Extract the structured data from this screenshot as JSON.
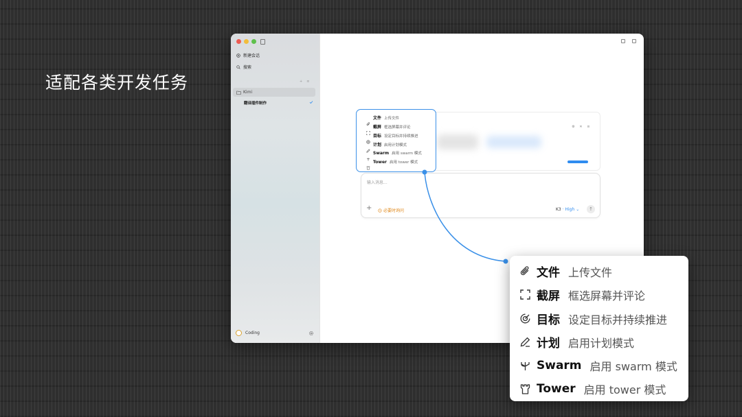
{
  "headline": "适配各类开发任务",
  "sidebar": {
    "new_chat": "新建会话",
    "search": "搜索",
    "section_label": "",
    "project": "Kimi",
    "task": "翻译插件制作",
    "footer_label": "Coding"
  },
  "composer": {
    "placeholder": "输入消息...",
    "plus": "+",
    "time_label": "必要时询问",
    "model_name": "K3",
    "model_level": "· High ⌄",
    "send": "↑"
  },
  "commands": [
    {
      "key": "file",
      "title": "文件",
      "desc": "上传文件",
      "icon": "paperclip-icon"
    },
    {
      "key": "screenshot",
      "title": "截屏",
      "desc": "框选屏幕并评论",
      "icon": "crop-icon"
    },
    {
      "key": "goal",
      "title": "目标",
      "desc": "设定目标并持续推进",
      "icon": "target-icon"
    },
    {
      "key": "plan",
      "title": "计划",
      "desc": "启用计划模式",
      "icon": "pen-icon"
    },
    {
      "key": "swarm",
      "title": "Swarm",
      "desc": "启用 swarm 模式",
      "icon": "swarm-icon"
    },
    {
      "key": "tower",
      "title": "Tower",
      "desc": "启用 tower 模式",
      "icon": "tower-icon"
    }
  ],
  "colors": {
    "accent": "#2f8cf0",
    "warning": "#e08a1e"
  }
}
